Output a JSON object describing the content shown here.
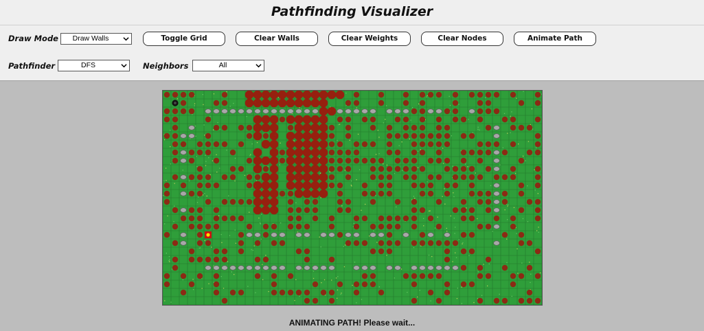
{
  "app": {
    "title": "Pathfinding Visualizer"
  },
  "toolbar": {
    "draw_mode_label": "Draw Mode",
    "draw_mode_value": "Draw Walls",
    "buttons": [
      "Toggle Grid",
      "Clear Walls",
      "Clear Weights",
      "Clear Nodes",
      "Animate Path"
    ],
    "pathfinder_label": "Pathfinder",
    "pathfinder_value": "DFS",
    "neighbors_label": "Neighbors",
    "neighbors_value": "All"
  },
  "status": "ANIMATING PATH! Please wait...",
  "colors": {
    "grass": "#2f9e3a",
    "gridline": "#1f6e28",
    "visited": "#8b2a14",
    "path": "#a0160c",
    "wall": "#a8a8a8",
    "start": "#cc1111",
    "end": "#111111"
  },
  "icons": {
    "start": "start-node-icon",
    "end": "end-node-icon",
    "wall": "rock-wall-icon",
    "visited": "visited-node-icon"
  }
}
